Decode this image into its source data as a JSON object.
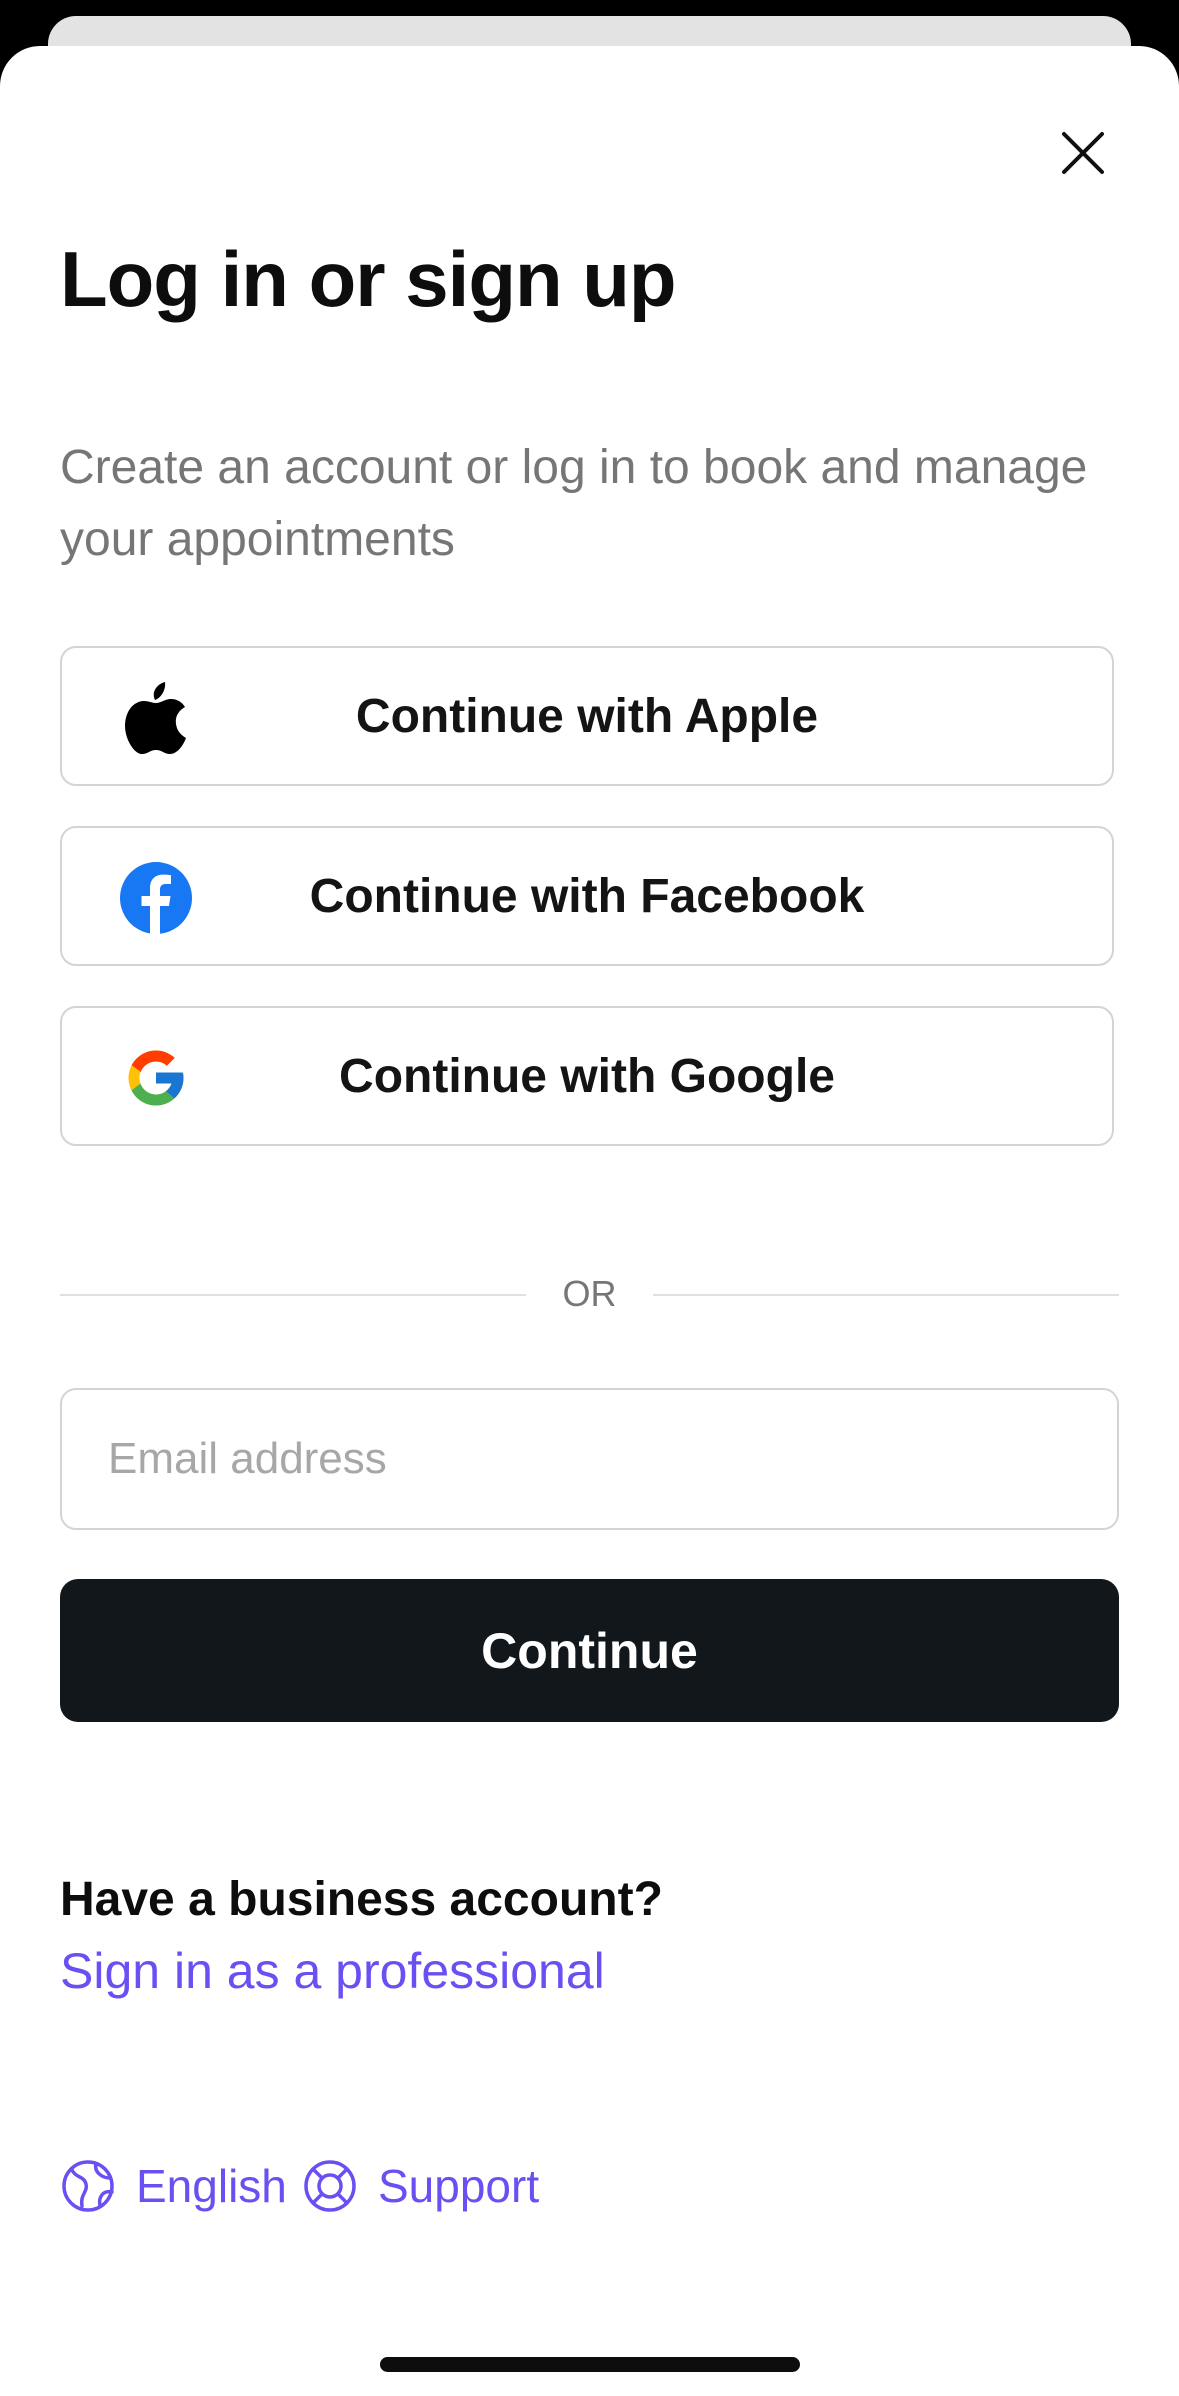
{
  "dialog": {
    "title": "Log in or sign up",
    "subtitle": "Create an account or log in to book and manage your appointments",
    "close_icon": "close-icon"
  },
  "social": [
    {
      "label": "Continue with Apple",
      "icon": "apple-icon"
    },
    {
      "label": "Continue with Facebook",
      "icon": "facebook-icon"
    },
    {
      "label": "Continue with Google",
      "icon": "google-icon"
    }
  ],
  "divider_text": "OR",
  "email": {
    "placeholder": "Email address",
    "value": ""
  },
  "continue_label": "Continue",
  "business": {
    "heading": "Have a business account?",
    "link": "Sign in as a professional"
  },
  "footer": {
    "language": {
      "label": "English",
      "icon": "globe-icon"
    },
    "support": {
      "label": "Support",
      "icon": "lifebuoy-icon"
    }
  },
  "colors": {
    "accent": "#6950f3",
    "primary_button": "#12171c",
    "facebook": "#1877f2"
  }
}
